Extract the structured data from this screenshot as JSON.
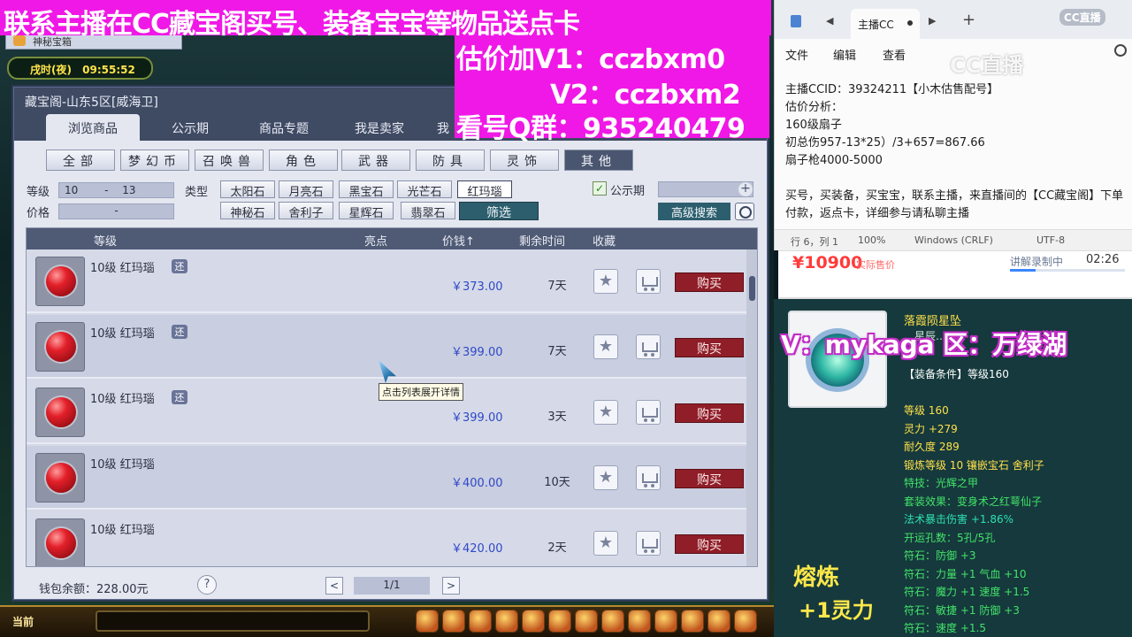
{
  "game": {
    "tab_label": "神秘宝箱",
    "time_of_day": "戌时(夜)",
    "clock": "09:55:52",
    "current_label": "当前"
  },
  "banner": {
    "headline": "联系主播在CC藏宝阁买号、装备宝宝等物品送点卡",
    "line1": "估价加V1：cczbxm0",
    "line2": "V2：cczbxm2",
    "line3": "看号Q群：935240479",
    "color": "#f018e6"
  },
  "treasure_window": {
    "title": "藏宝阁-山东5区[威海卫]",
    "nav_tabs": [
      "浏览商品",
      "公示期",
      "商品专题",
      "我是卖家",
      "我"
    ],
    "categories": [
      "全部",
      "梦幻币",
      "召唤兽",
      "角色",
      "武器",
      "防具",
      "灵饰",
      "其他"
    ],
    "active_category": "其他",
    "level_label": "等级",
    "level_from": "10",
    "level_sep": "-",
    "level_to": "13",
    "price_label": "价格",
    "price_sep": "-",
    "type_label": "类型",
    "types": [
      "太阳石",
      "月亮石",
      "黑宝石",
      "光芒石",
      "红玛瑙",
      "神秘石",
      "舍利子",
      "星辉石",
      "翡翠石"
    ],
    "selected_type": "红玛瑙",
    "filter_label": "筛选",
    "public_label": "公示期",
    "advanced_label": "高级搜索",
    "columns": {
      "level": "等级",
      "highlight": "亮点",
      "price": "价钱↑",
      "time_left": "剩余时间",
      "favorite": "收藏"
    },
    "items": [
      {
        "name": "10级 红玛瑙",
        "badge": "还",
        "price": "￥373.00",
        "days": "7天",
        "buy": "购买"
      },
      {
        "name": "10级 红玛瑙",
        "badge": "还",
        "price": "￥399.00",
        "days": "7天",
        "buy": "购买"
      },
      {
        "name": "10级 红玛瑙",
        "badge": "还",
        "price": "￥399.00",
        "days": "3天",
        "buy": "购买"
      },
      {
        "name": "10级 红玛瑙",
        "badge": "",
        "price": "￥400.00",
        "days": "10天",
        "buy": "购买"
      },
      {
        "name": "10级 红玛瑙",
        "badge": "",
        "price": "￥420.00",
        "days": "2天",
        "buy": "购买"
      }
    ],
    "tooltip": "点击列表展开详情",
    "wallet": "钱包余额：228.00元",
    "help": "?",
    "page": "1/1",
    "prev": "<",
    "next": ">"
  },
  "notepad": {
    "tab_title": "主播CC",
    "menu": [
      "文件",
      "编辑",
      "查看"
    ],
    "logo": "CC直播",
    "watermark": "CC直播",
    "lines": [
      "主播CCID：39324211【小木估售配号】",
      "估价分析：",
      "160级扇子",
      "初总伤957-13*25）/3+657=867.66",
      "扇子枪4000-5000",
      "",
      "买号，买装备，买宝宝，联系主播，来直播间的【CC藏宝阁】下单付款，返点卡，详细参与请私聊主播"
    ],
    "status": {
      "position": "行 6，列 1",
      "zoom": "100%",
      "line_ending": "Windows (CRLF)",
      "encoding": "UTF-8"
    }
  },
  "price_strip": {
    "price": "¥10900",
    "sub": "实际售价",
    "explain": "讲解录制中",
    "time": "02:26",
    "progress": 0.22
  },
  "item_panel": {
    "title": "落霞陨星坠",
    "subline": "…星辰…玉，",
    "overlay": "V：mykaga  区：万绿湖",
    "requirement": "【装备条件】等级160",
    "stats": [
      {
        "text": "等级 160",
        "color": "yellow"
      },
      {
        "text": "灵力 +279",
        "color": "yellow"
      },
      {
        "text": "耐久度 289",
        "color": "yellow"
      },
      {
        "text": "锻炼等级 10 镶嵌宝石 舍利子",
        "color": "yellow"
      },
      {
        "text": "特技：光辉之甲",
        "color": "green"
      },
      {
        "text": "套装效果：变身术之红萼仙子",
        "color": "green"
      },
      {
        "text": "法术暴击伤害 +1.86%",
        "color": "teal"
      },
      {
        "text": "开运孔数：5孔/5孔",
        "color": "green"
      },
      {
        "text": "符石：防御 +3",
        "color": "green"
      },
      {
        "text": "符石：力量 +1 气血 +10",
        "color": "green"
      },
      {
        "text": "符石：魔力 +1 速度 +1.5",
        "color": "green"
      },
      {
        "text": "符石：敏捷 +1 防御 +3",
        "color": "green"
      },
      {
        "text": "符石：速度 +1.5",
        "color": "green"
      }
    ],
    "big1": "熔炼",
    "big2": "+1灵力"
  }
}
